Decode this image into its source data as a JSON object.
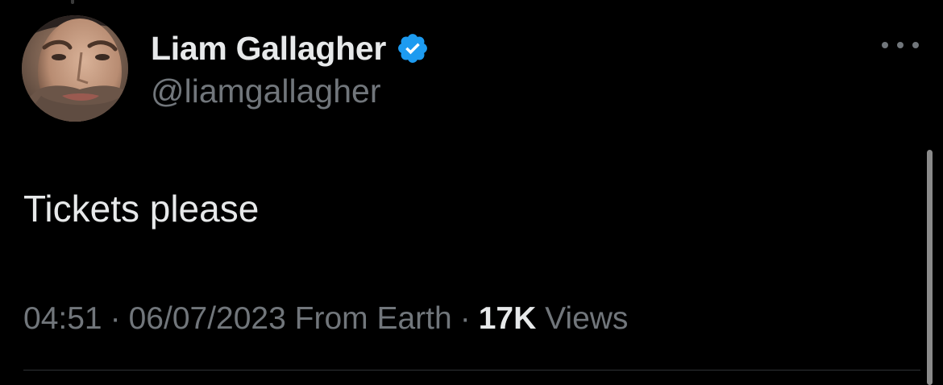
{
  "tweet": {
    "author": {
      "display_name": "Liam Gallagher",
      "handle": "@liamgallagher",
      "verified": true,
      "verified_color": "#1d9bf0",
      "avatar_icon": "profile-photo"
    },
    "text": "Tickets please",
    "meta": {
      "time": "04:51",
      "separator": "·",
      "date": "06/07/2023",
      "source": "From Earth",
      "views_count": "17K",
      "views_label": "Views"
    },
    "menu_icon": "more-horizontal-icon"
  },
  "theme": {
    "background": "#000000",
    "text_primary": "#e7e9ea",
    "text_secondary": "#71767b",
    "divider": "#2f3336"
  }
}
